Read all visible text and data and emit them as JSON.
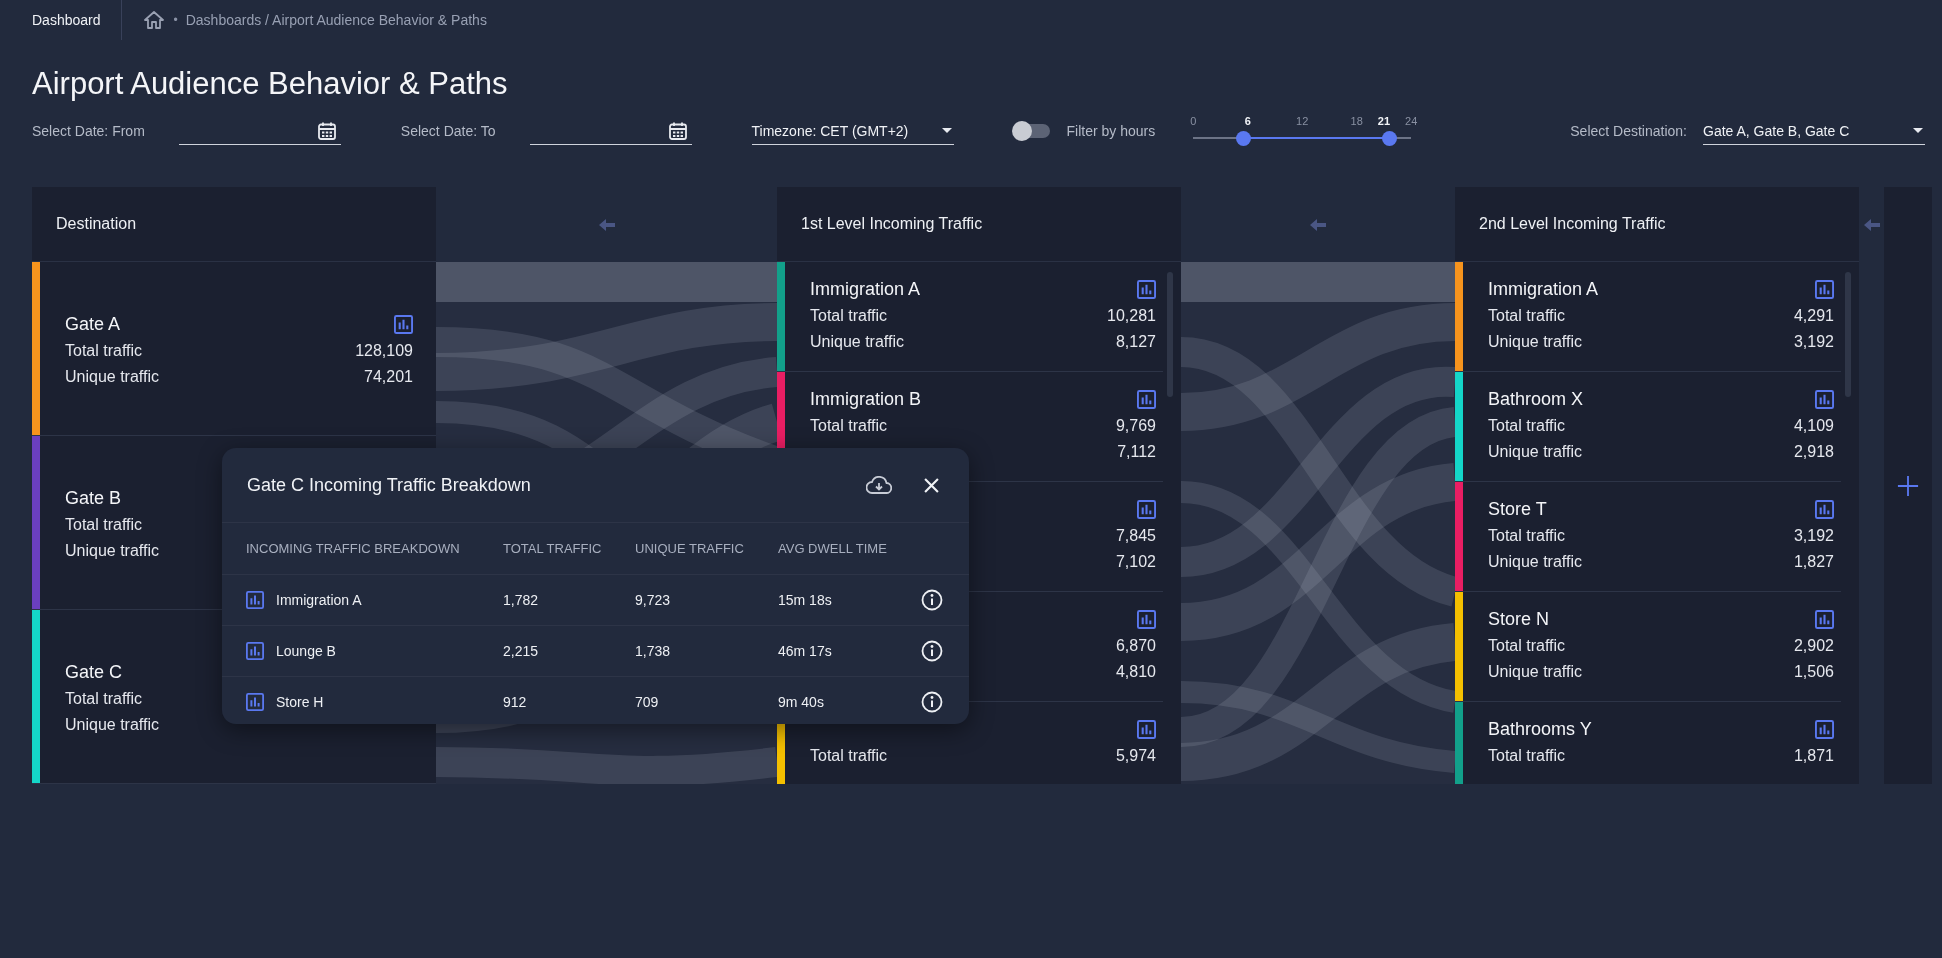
{
  "top_bar": {
    "root": "Dashboard",
    "separator": "•",
    "breadcrumb": "Dashboards / Airport Audience Behavior & Paths"
  },
  "title": "Airport Audience Behavior & Paths",
  "filters": {
    "date_from": {
      "label": "Select Date: From"
    },
    "date_to": {
      "label": "Select Date: To"
    },
    "timezone": {
      "value": "Timezone: CET (GMT+2)"
    },
    "hour_filter": {
      "label": "Filter by hours",
      "on": false,
      "ticks": [
        {
          "label": "0",
          "selected": false
        },
        {
          "label": "6",
          "selected": true
        },
        {
          "label": "12",
          "selected": false
        },
        {
          "label": "18",
          "selected": false
        },
        {
          "label": "21",
          "selected": true
        },
        {
          "label": "24",
          "selected": false
        }
      ]
    },
    "destination": {
      "label": "Select Destination:",
      "value": "Gate A, Gate B, Gate C"
    }
  },
  "columns": [
    {
      "title": "Destination",
      "items": [
        {
          "name": "Gate A",
          "color": "#f7941d",
          "metrics": [
            {
              "label": "Total traffic",
              "value": "128,109"
            },
            {
              "label": "Unique traffic",
              "value": "74,201"
            }
          ]
        },
        {
          "name": "Gate B",
          "color": "#6b3fc0",
          "metrics": [
            {
              "label": "Total traffic"
            },
            {
              "label": "Unique traffic"
            }
          ]
        },
        {
          "name": "Gate C",
          "color": "#14d6c8",
          "metrics": [
            {
              "label": "Total traffic"
            },
            {
              "label": "Unique traffic"
            }
          ]
        }
      ]
    },
    {
      "title": "1st Level Incoming Traffic",
      "items": [
        {
          "name": "Immigration A",
          "color": "#12a08a",
          "metrics": [
            {
              "label": "Total traffic",
              "value": "10,281"
            },
            {
              "label": "Unique traffic",
              "value": "8,127"
            }
          ]
        },
        {
          "name": "Immigration B",
          "color": "#e91e63",
          "metrics": [
            {
              "label": "Total traffic",
              "value": "9,769"
            },
            {
              "value": "7,112"
            }
          ]
        },
        {
          "metrics": [
            {
              "value": "7,845"
            },
            {
              "value": "7,102"
            }
          ]
        },
        {
          "metrics": [
            {
              "value": "6,870"
            },
            {
              "value": "4,810"
            }
          ]
        },
        {
          "color": "#f5c000",
          "metrics": [
            {
              "label": "Total traffic",
              "value": "5,974"
            }
          ]
        }
      ]
    },
    {
      "title": "2nd Level Incoming Traffic",
      "items": [
        {
          "name": "Immigration A",
          "color": "#f7941d",
          "metrics": [
            {
              "label": "Total traffic",
              "value": "4,291"
            },
            {
              "label": "Unique traffic",
              "value": "3,192"
            }
          ]
        },
        {
          "name": "Bathroom X",
          "color": "#14d6c8",
          "metrics": [
            {
              "label": "Total traffic",
              "value": "4,109"
            },
            {
              "label": "Unique traffic",
              "value": "2,918"
            }
          ]
        },
        {
          "name": "Store T",
          "color": "#e91e63",
          "metrics": [
            {
              "label": "Total traffic",
              "value": "3,192"
            },
            {
              "label": "Unique traffic",
              "value": "1,827"
            }
          ]
        },
        {
          "name": "Store N",
          "color": "#f5c000",
          "metrics": [
            {
              "label": "Total traffic",
              "value": "2,902"
            },
            {
              "label": "Unique traffic",
              "value": "1,506"
            }
          ]
        },
        {
          "name": "Bathrooms Y",
          "color": "#12a08a",
          "metrics": [
            {
              "label": "Total traffic",
              "value": "1,871"
            }
          ]
        }
      ]
    }
  ],
  "popup": {
    "title": "Gate C Incoming Traffic Breakdown",
    "columns": [
      "INCOMING TRAFFIC BREAKDOWN",
      "TOTAL TRAFFIC",
      "UNIQUE TRAFFIC",
      "AVG DWELL TIME"
    ],
    "rows": [
      {
        "cells": [
          "Immigration A",
          "1,782",
          "9,723",
          "15m 18s"
        ]
      },
      {
        "cells": [
          "Lounge B",
          "2,215",
          "1,738",
          "46m 17s"
        ]
      },
      {
        "cells": [
          "Store H",
          "912",
          "709",
          "9m 40s"
        ]
      }
    ]
  }
}
